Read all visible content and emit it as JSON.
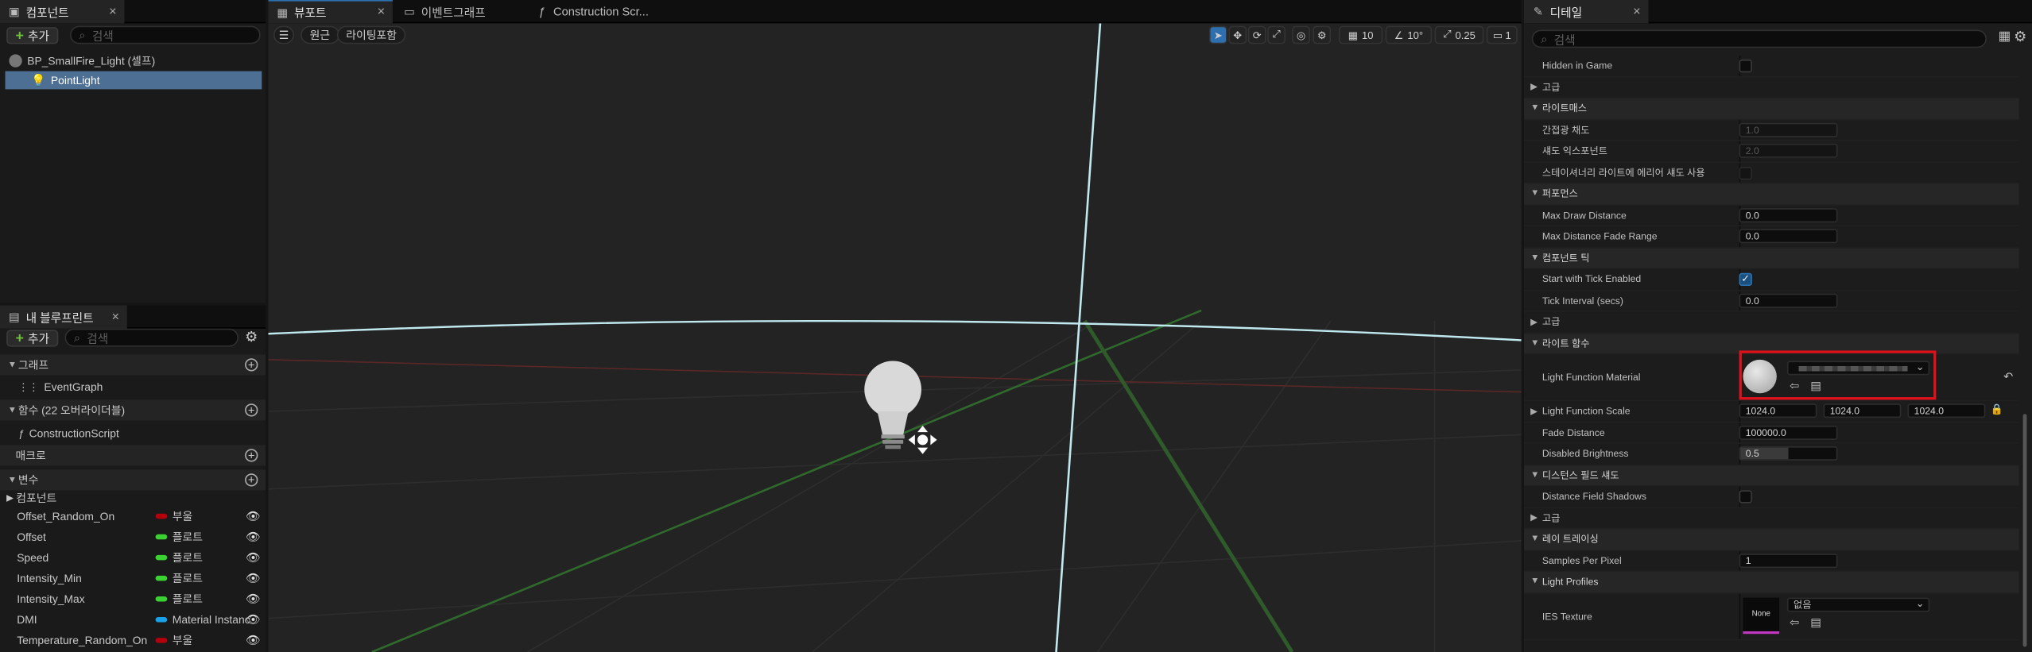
{
  "components_panel": {
    "tab_title": "컴포넌트",
    "add_label": "추가",
    "search_placeholder": "검색",
    "tree": [
      {
        "label": "BP_SmallFire_Light (셀프)"
      },
      {
        "label": "PointLight",
        "selected": true
      }
    ]
  },
  "viewport_tabs": [
    {
      "label": "뷰포트",
      "active": true
    },
    {
      "label": "이벤트그래프"
    },
    {
      "label": "Construction Scr..."
    }
  ],
  "viewport": {
    "perspective_label": "원근",
    "lighting_label": "라이팅포함",
    "grid_value": "10",
    "rotation_value": "10°",
    "scale_value": "0.25",
    "camera_speed": "1"
  },
  "my_blueprint": {
    "tab_title": "내 블루프린트",
    "add_label": "추가",
    "search_placeholder": "검색",
    "sections": {
      "graphs": "그래프",
      "event_graph": "EventGraph",
      "functions": "함수 (22 오버라이더블)",
      "construction_script": "ConstructionScript",
      "macros": "매크로",
      "variables": "변수",
      "components": "컴포넌트"
    },
    "variables": [
      {
        "name": "Offset_Random_On",
        "type": "부울",
        "color": "#b3000a"
      },
      {
        "name": "Offset",
        "type": "플로트",
        "color": "#3bd133"
      },
      {
        "name": "Speed",
        "type": "플로트",
        "color": "#3bd133"
      },
      {
        "name": "Intensity_Min",
        "type": "플로트",
        "color": "#3bd133"
      },
      {
        "name": "Intensity_Max",
        "type": "플로트",
        "color": "#3bd133"
      },
      {
        "name": "DMI",
        "type": "Material Instanc",
        "color": "#1aa0e6"
      },
      {
        "name": "Temperature_Random_On",
        "type": "부울",
        "color": "#b3000a"
      }
    ]
  },
  "details": {
    "tab_title": "디테일",
    "search_placeholder": "검색",
    "hidden_in_game": "Hidden in Game",
    "advanced": "고급",
    "lightmass": "라이트매스",
    "indirect_intensity": "간접광 채도",
    "indirect_value": "1.0",
    "shadow_exponent": "섀도 익스포넌트",
    "shadow_value": "2.0",
    "stationary_shadow": "스테이셔너리 라이트에 에리어 섀도 사용",
    "performance": "퍼포먼스",
    "max_draw_distance": "Max Draw Distance",
    "max_draw_value": "0.0",
    "max_fade_range": "Max Distance Fade Range",
    "max_fade_value": "0.0",
    "component_tick": "컴포넌트 틱",
    "start_tick": "Start with Tick Enabled",
    "tick_interval": "Tick Interval (secs)",
    "tick_interval_value": "0.0",
    "light_function": "라이트 함수",
    "lf_material": "Light Function Material",
    "lf_scale": "Light Function Scale",
    "lf_scale_x": "1024.0",
    "lf_scale_y": "1024.0",
    "lf_scale_z": "1024.0",
    "fade_distance": "Fade Distance",
    "fade_distance_value": "100000.0",
    "disabled_brightness": "Disabled Brightness",
    "disabled_brightness_value": "0.5",
    "dist_field": "디스턴스 필드 섀도",
    "dist_field_shadows": "Distance Field Shadows",
    "ray_tracing": "레이 트레이싱",
    "samples_per_pixel": "Samples Per Pixel",
    "samples_value": "1",
    "light_profiles": "Light Profiles",
    "ies_texture": "IES Texture",
    "ies_none": "None",
    "ies_dropdown": "없음"
  },
  "colors": {
    "accent_blue": "#2e6fb0",
    "highlight_red": "#e0111b",
    "selection": "#4c6f93"
  }
}
